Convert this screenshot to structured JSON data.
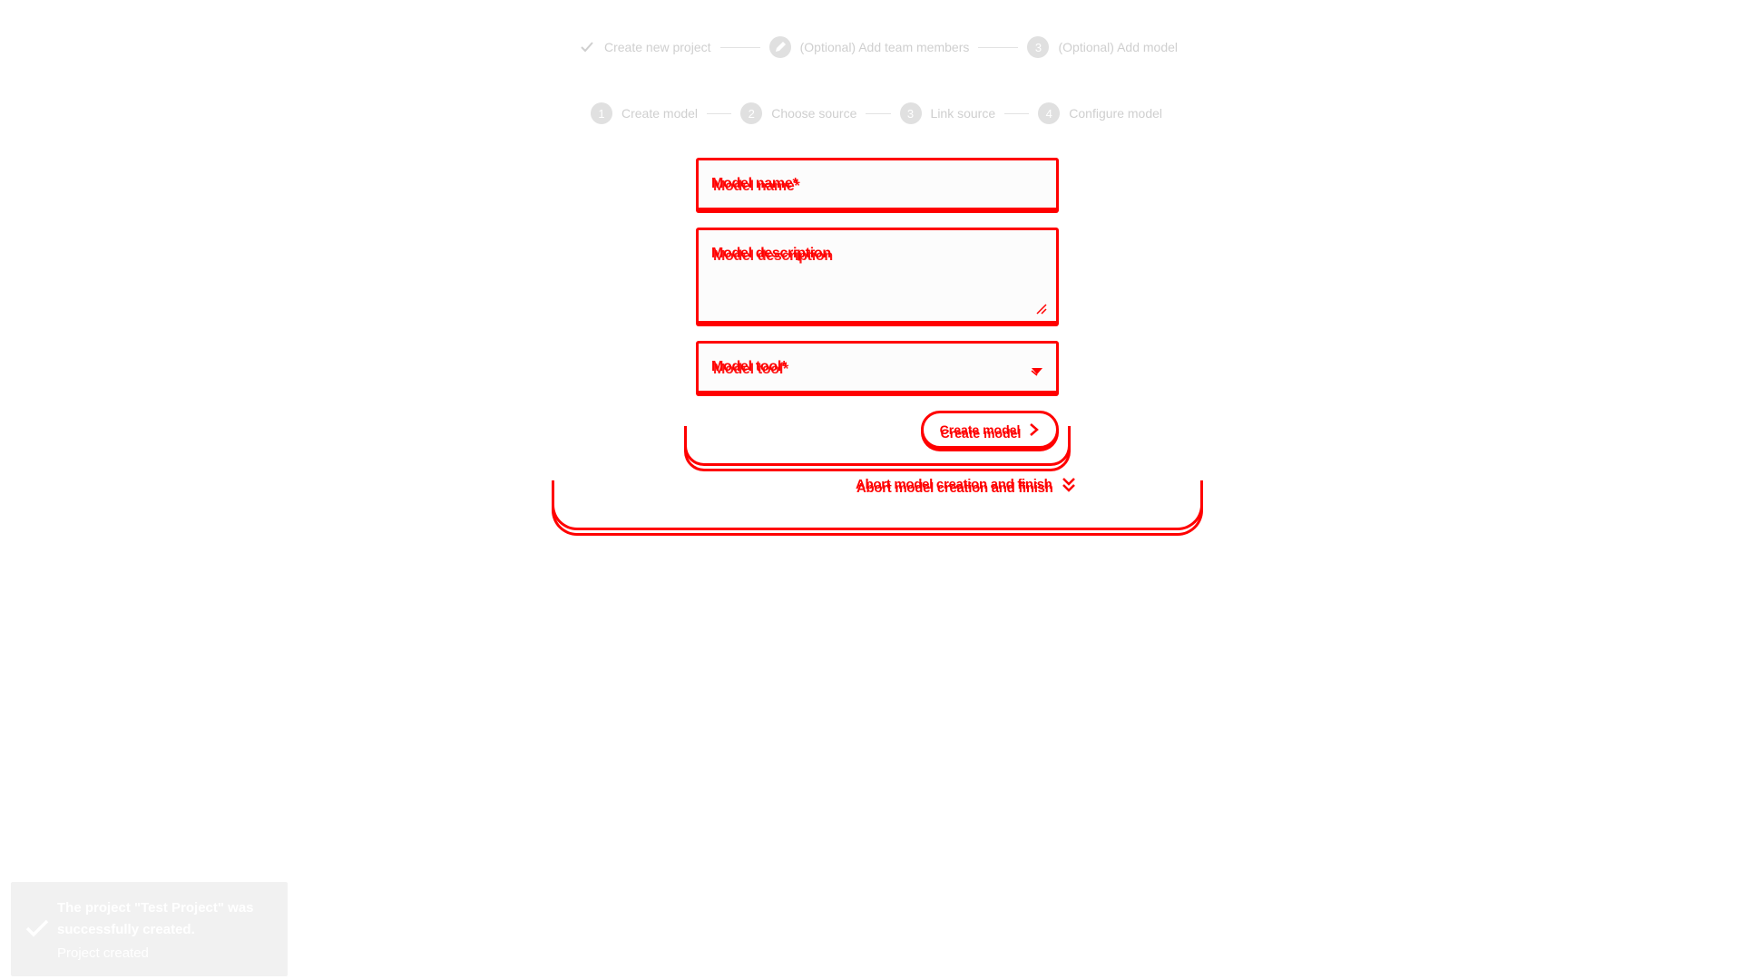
{
  "project_stepper": {
    "steps": [
      {
        "label": "Create new project",
        "state": "done",
        "icon": "check-icon"
      },
      {
        "label": "(Optional) Add team members",
        "state": "active",
        "icon": "pencil-icon"
      },
      {
        "label": "(Optional) Add model",
        "state": "pending",
        "badge": "3"
      }
    ]
  },
  "model_stepper": {
    "steps": [
      {
        "badge": "1",
        "label": "Create model"
      },
      {
        "badge": "2",
        "label": "Choose source"
      },
      {
        "badge": "3",
        "label": "Link source"
      },
      {
        "badge": "4",
        "label": "Configure model"
      }
    ]
  },
  "form": {
    "model_name_label": "Model name*",
    "model_description_label": "Model description",
    "model_tool_label": "Model tool*",
    "create_button": "Create model",
    "abort_link": "Abort model creation and finish"
  },
  "toast": {
    "message": "The project \"Test Project\" was successfully created.",
    "title": "Project created",
    "icon": "check-icon"
  },
  "colors": {
    "accent": "#ff0000",
    "muted_text": "#cfcfcf",
    "toast_bg": "#f1f1f1"
  }
}
